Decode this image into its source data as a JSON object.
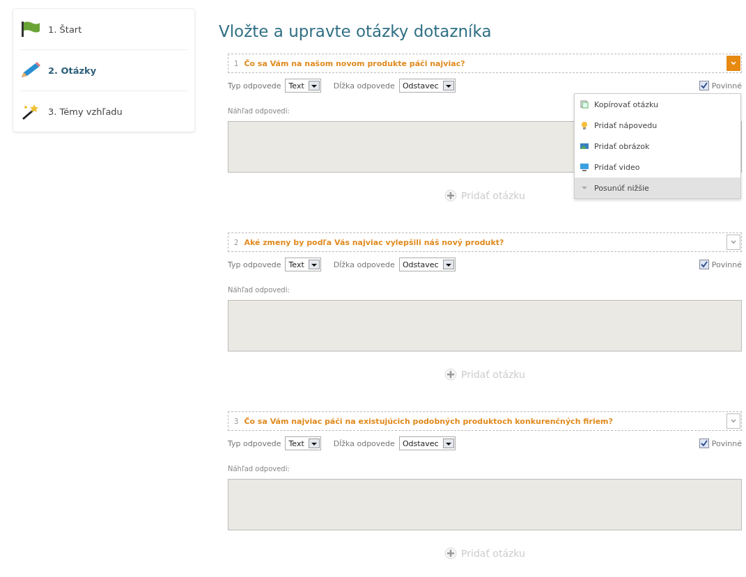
{
  "sidebar": {
    "items": [
      {
        "label": "1. Štart",
        "selected": false
      },
      {
        "label": "2. Otázky",
        "selected": true
      },
      {
        "label": "3. Témy vzhľadu",
        "selected": false
      }
    ]
  },
  "page_title": "Vložte a upravte otázky dotazníka",
  "questions": [
    {
      "number": "1",
      "text": "Čo sa Vám na našom novom produkte páči najviac?",
      "type_label": "Typ odpovede",
      "type_value": "Text",
      "length_label": "Dĺžka odpovede",
      "length_value": "Odstavec",
      "required_label": "Povinné",
      "required": true,
      "preview_label": "Náhľad odpovedi:",
      "add_label": "Pridať otázku",
      "menu_open": true,
      "menu": [
        {
          "label": "Kopírovať otázku",
          "selected": false
        },
        {
          "label": "Pridať nápovedu",
          "selected": false
        },
        {
          "label": "Pridať obrázok",
          "selected": false
        },
        {
          "label": "Pridať video",
          "selected": false
        },
        {
          "label": "Posunúť nižšie",
          "selected": true
        }
      ]
    },
    {
      "number": "2",
      "text": "Aké zmeny by podľa Vás najviac vylepšili náš nový produkt?",
      "type_label": "Typ odpovede",
      "type_value": "Text",
      "length_label": "Dĺžka odpovede",
      "length_value": "Odstavec",
      "required_label": "Povinné",
      "required": true,
      "preview_label": "Náhľad odpovedi:",
      "add_label": "Pridať otázku",
      "menu_open": false
    },
    {
      "number": "3",
      "text": "Čo sa Vám najviac páči na existujúcich podobných produktoch konkurenčných firiem?",
      "type_label": "Typ odpovede",
      "type_value": "Text",
      "length_label": "Dĺžka odpovede",
      "length_value": "Odstavec",
      "required_label": "Povinné",
      "required": true,
      "preview_label": "Náhľad odpovedi:",
      "add_label": "Pridať otázku",
      "menu_open": false
    }
  ]
}
